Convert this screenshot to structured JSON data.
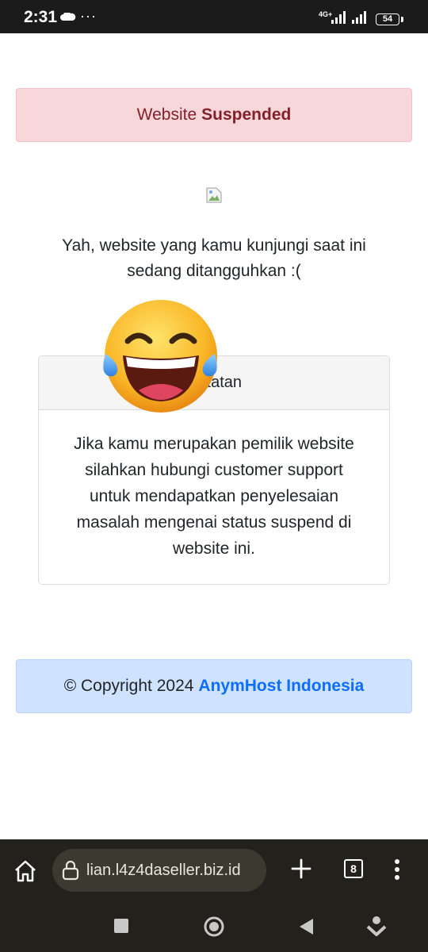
{
  "status_bar": {
    "time": "2:31",
    "dots": "···",
    "network": "4G+",
    "battery": "54"
  },
  "alert": {
    "prefix": "Website",
    "bold": "Suspended"
  },
  "message": {
    "line1": "Yah, website yang kamu kunjungi saat ini",
    "line2": "sedang ditangguhkan :("
  },
  "card": {
    "header": "Catatan",
    "body": "Jika kamu merupakan pemilik website silahkan hubungi customer support untuk mendapatkan penyelesaian masalah mengenai status suspend di website ini."
  },
  "footer": {
    "copyright": "© Copyright 2024",
    "brand": "AnymHost Indonesia"
  },
  "browser": {
    "url": "lian.l4z4daseller.biz.id",
    "tab_count": "8"
  },
  "icons": [
    "cloud-icon",
    "signal-icon",
    "battery-icon",
    "broken-image-icon",
    "laughing-emoji",
    "home-icon",
    "lock-icon",
    "plus-icon",
    "tabs-icon",
    "menu-icon",
    "nav-recents-icon",
    "nav-home-icon",
    "nav-back-icon",
    "nav-assist-icon"
  ],
  "colors": {
    "alert_bg": "#f8d7da",
    "alert_text": "#842029",
    "footer_bg": "#cfe2ff",
    "brand_link": "#0d6efd",
    "chrome_bg": "#22211b"
  }
}
